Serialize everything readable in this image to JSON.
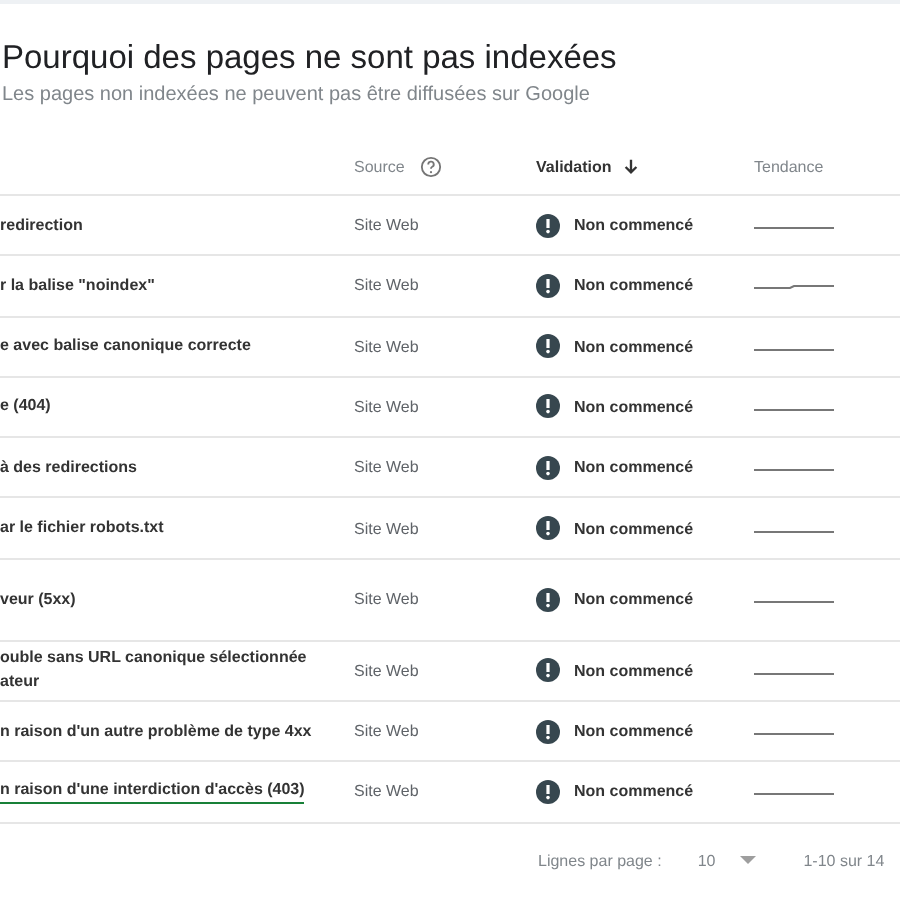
{
  "title": "Pourquoi des pages ne sont pas indexées",
  "subtitle": "Les pages non indexées ne peuvent pas être diffusées sur Google",
  "table": {
    "columns": [
      {
        "label": "Source",
        "kind": "help"
      },
      {
        "label": "Validation",
        "kind": "sorted"
      },
      {
        "label": "Tendance",
        "kind": "plain"
      }
    ],
    "rows": [
      {
        "issue": "redirection",
        "source": "Site Web",
        "validation": "Non commencé",
        "underlined": false
      },
      {
        "issue": "r la balise \"noindex\"",
        "source": "Site Web",
        "validation": "Non commencé",
        "underlined": false
      },
      {
        "issue": "e avec balise canonique correcte",
        "source": "Site Web",
        "validation": "Non commencé",
        "underlined": false
      },
      {
        "issue": "e (404)",
        "source": "Site Web",
        "validation": "Non commencé",
        "underlined": false
      },
      {
        "issue": "à des redirections",
        "source": "Site Web",
        "validation": "Non commencé",
        "underlined": false
      },
      {
        "issue": "ar le fichier robots.txt",
        "source": "Site Web",
        "validation": "Non commencé",
        "underlined": false
      },
      {
        "issue": "veur (5xx)",
        "source": "Site Web",
        "validation": "Non commencé",
        "underlined": false
      },
      {
        "issue": "ouble sans URL canonique sélectionnée\nateur",
        "source": "Site Web",
        "validation": "Non commencé",
        "underlined": false
      },
      {
        "issue": "n raison d'un autre problème de type 4xx",
        "source": "Site Web",
        "validation": "Non commencé",
        "underlined": false
      },
      {
        "issue": "n raison d'une interdiction d'accès (403)",
        "source": "Site Web",
        "validation": "Non commencé",
        "underlined": true
      }
    ]
  },
  "pagination": {
    "rows_label": "Lignes par page :",
    "rows_value": "10",
    "range": "1-10 sur 14"
  }
}
